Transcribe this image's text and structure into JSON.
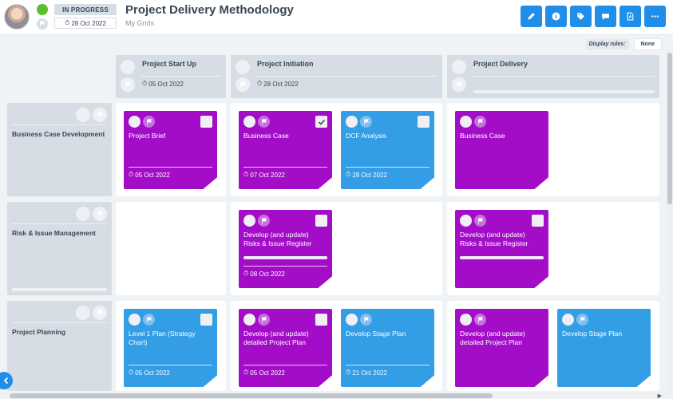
{
  "header": {
    "status_label": "IN PROGRESS",
    "date": "28 Oct 2022",
    "title": "Project Delivery Methodology",
    "breadcrumb": "My Grids",
    "status_color": "#5cbf2a",
    "toolbar_icons": [
      "pencil-icon",
      "info-icon",
      "tags-icon",
      "comment-icon",
      "pdf-icon",
      "more-icon"
    ]
  },
  "display_rules": {
    "label": "Display rules:",
    "value": "None"
  },
  "columns": [
    {
      "name": "Project Start Up",
      "date": "05 Oct 2022"
    },
    {
      "name": "Project Initiation",
      "date": "28 Oct 2022"
    },
    {
      "name": "Project Delivery",
      "date": ""
    }
  ],
  "rows": [
    {
      "name": "Business Case Development"
    },
    {
      "name": "Risk & Issue Management"
    },
    {
      "name": "Project Planning"
    }
  ],
  "colors": {
    "purple": "#a30dc8",
    "blue": "#339de6",
    "accent": "#1e8ee8"
  },
  "cards": {
    "r1c1": [
      {
        "title": "Project Brief",
        "date": "05 Oct 2022",
        "color": "purple",
        "checked": false
      }
    ],
    "r1c2": [
      {
        "title": "Business Case",
        "date": "07 Oct 2022",
        "color": "purple",
        "checked": true
      },
      {
        "title": "DCF Analysis",
        "date": "28 Oct 2022",
        "color": "blue",
        "checked": false
      }
    ],
    "r1c3": [
      {
        "title": "Business Case",
        "date": "",
        "color": "purple",
        "checked": false
      }
    ],
    "r2c2": [
      {
        "title": "Develop (and update) Risks & Issue Register",
        "date": "08 Oct 2022",
        "color": "purple",
        "progress": true
      }
    ],
    "r2c3": [
      {
        "title": "Develop (and update) Risks & Issue Register",
        "date": "",
        "color": "purple",
        "progress": true
      }
    ],
    "r3c1": [
      {
        "title": "Level 1 Plan (Strategy Chart)",
        "date": "05 Oct 2022",
        "color": "blue"
      }
    ],
    "r3c2": [
      {
        "title": "Develop (and update) detailed Project Plan",
        "date": "05 Oct 2022",
        "color": "purple"
      },
      {
        "title": "Develop Stage Plan",
        "date": "21 Oct 2022",
        "color": "blue"
      }
    ],
    "r3c3": [
      {
        "title": "Develop (and update) detailed Project Plan",
        "date": "",
        "color": "purple"
      },
      {
        "title": "Develop Stage Plan",
        "date": "",
        "color": "blue"
      }
    ]
  }
}
